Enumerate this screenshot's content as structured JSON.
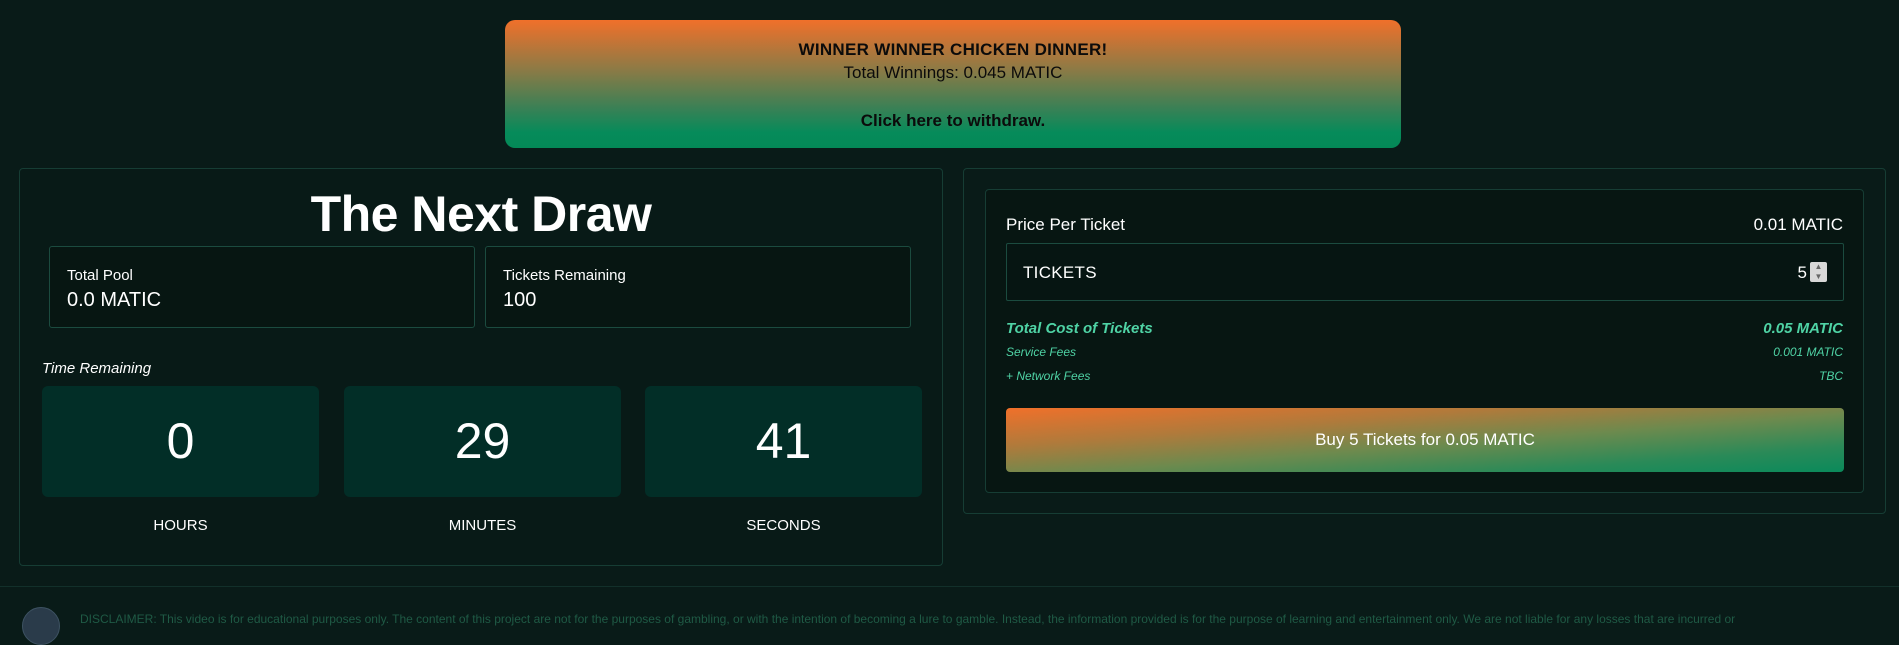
{
  "banner": {
    "headline": "WINNER WINNER CHICKEN DINNER!",
    "winnings": "Total Winnings: 0.045 MATIC",
    "withdraw": "Click here to withdraw."
  },
  "draw": {
    "title": "The Next Draw",
    "total_pool_label": "Total Pool",
    "total_pool_value": "0.0 MATIC",
    "tickets_remaining_label": "Tickets Remaining",
    "tickets_remaining_value": "100",
    "time_remaining_label": "Time Remaining",
    "hours": "0",
    "minutes": "29",
    "seconds": "41",
    "hours_label": "HOURS",
    "minutes_label": "MINUTES",
    "seconds_label": "SECONDS"
  },
  "purchase": {
    "price_label": "Price Per Ticket",
    "price_value": "0.01 MATIC",
    "tickets_label": "TICKETS",
    "tickets_qty": "5",
    "total_cost_label": "Total Cost of Tickets",
    "total_cost_value": "0.05 MATIC",
    "service_fees_label": "Service Fees",
    "service_fees_value": "0.001 MATIC",
    "network_fees_label": "+ Network Fees",
    "network_fees_value": "TBC",
    "buy_button": "Buy 5 Tickets for 0.05 MATIC"
  },
  "footer": {
    "disclaimer": "DISCLAIMER: This video is for educational purposes only. The content of this project are not for the purposes of gambling, or with the intention of becoming a lure to gamble. Instead, the information provided is for the purpose of learning and entertainment only. We are not liable for any losses that are incurred or"
  },
  "colors": {
    "background": "#091b18",
    "accent_green": "#4fd3a5",
    "gradient_orange": "#f0702a",
    "gradient_green": "#048957",
    "timer_box": "#022e27"
  }
}
